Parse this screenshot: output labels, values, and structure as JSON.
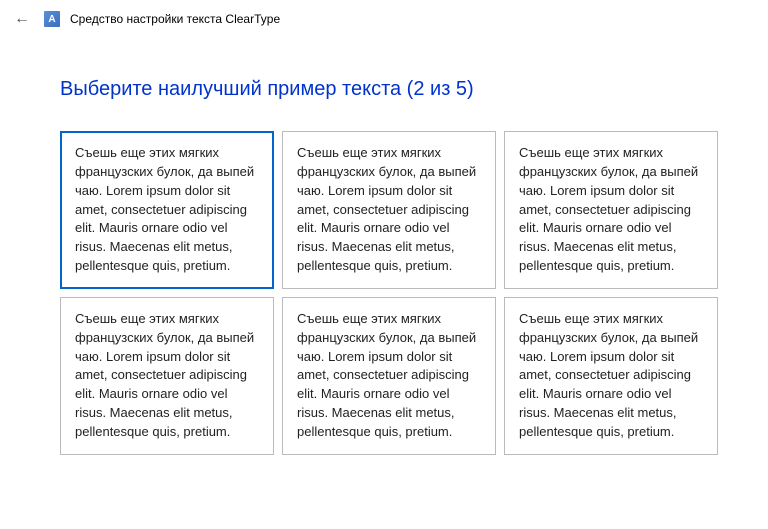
{
  "titlebar": {
    "title": "Средство настройки текста ClearType",
    "icon_letter": "A"
  },
  "heading": "Выберите наилучший пример текста (2 из 5)",
  "sample_text": "Съешь еще этих мягких французских булок, да выпей чаю. Lorem ipsum dolor sit amet, consectetuer adipiscing elit. Mauris ornare odio vel risus. Maecenas elit metus, pellentesque quis, pretium.",
  "samples": [
    {
      "selected": true
    },
    {
      "selected": false
    },
    {
      "selected": false
    },
    {
      "selected": false
    },
    {
      "selected": false
    },
    {
      "selected": false
    }
  ],
  "colors": {
    "accent": "#0033cc",
    "selection_border": "#0066cc",
    "border": "#bbbbbb"
  }
}
